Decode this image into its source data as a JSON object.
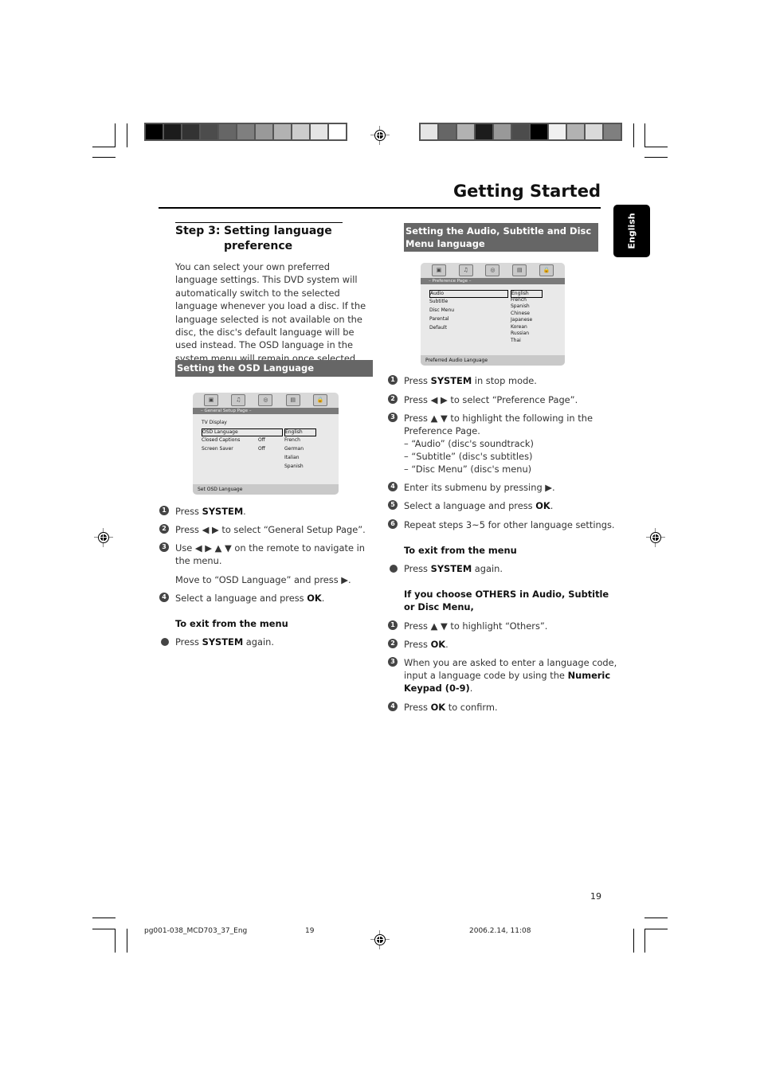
{
  "header": {
    "title": "Getting Started",
    "side_tab": "English",
    "color_bar_left": [
      "#000000",
      "#1c1c1c",
      "#333333",
      "#4c4c4c",
      "#666666",
      "#7f7f7f",
      "#999999",
      "#b2b2b2",
      "#cccccc",
      "#e5e5e5",
      "#ffffff"
    ],
    "color_bar_right": [
      "#e5e5e5",
      "#666666",
      "#b2b2b2",
      "#1c1c1c",
      "#999999",
      "#4c4c4c",
      "#000000",
      "#f0f0f0",
      "#b2b2b2",
      "#d9d9d9",
      "#7f7f7f"
    ]
  },
  "left": {
    "step_label": "Step 3:",
    "step_title_1": "Setting language",
    "step_title_2": "preference",
    "intro": "You can select your own preferred language settings. This DVD system will automatically switch to the selected language whenever you load a disc. If the language selected is not available on the disc, the disc's default language will be used instead. The OSD language in the system menu will remain once selected.",
    "section_header": "Setting the OSD Language",
    "osd": {
      "page_title": "– General Setup Page –",
      "icons": [
        "tv-icon",
        "audio-icon",
        "disc-icon",
        "video-icon",
        "lock-icon"
      ],
      "rows": [
        {
          "label": "TV Display",
          "value": ""
        },
        {
          "label": "OSD Language",
          "value": ""
        },
        {
          "label": "Closed Captions",
          "value": "Off"
        },
        {
          "label": "Screen Saver",
          "value": "Off"
        }
      ],
      "options": [
        "English",
        "French",
        "German",
        "Italian",
        "Spanish"
      ],
      "footer": "Set OSD Language"
    },
    "steps": [
      {
        "num": "1",
        "pre": "Press ",
        "bold": "SYSTEM",
        "post": "."
      },
      {
        "num": "2",
        "pre": "Press ◀ ▶  to select “General Setup Page”.",
        "bold": "",
        "post": ""
      },
      {
        "num": "3",
        "pre": "Use ◀ ▶ ▲ ▼  on the remote to navigate in",
        "bold": "",
        "post": ""
      },
      {
        "num": "",
        "pre": "the menu.",
        "bold": "",
        "post": ""
      },
      {
        "num": "",
        "pre": "Move to “OSD Language” and press ▶.",
        "bold": "",
        "post": ""
      },
      {
        "num": "4",
        "pre": "Select a language and press ",
        "bold": "OK",
        "post": "."
      }
    ],
    "exit_heading": "To exit from the menu",
    "exit_step": {
      "pre": "Press ",
      "bold": "SYSTEM",
      "post": " again."
    }
  },
  "right": {
    "section_header_1": "Setting the Audio, Subtitle and Disc",
    "section_header_2": "Menu language",
    "osd": {
      "page_title": "– Preference Page –",
      "icons": [
        "tv-icon",
        "audio-icon",
        "disc-icon",
        "video-icon",
        "lock-icon"
      ],
      "rows": [
        "Audio",
        "Subtitle",
        "Disc Menu",
        "Parental",
        "Default"
      ],
      "options": [
        "English",
        "French",
        "Spanish",
        "Chinese",
        "Japanese",
        "Korean",
        "Russian",
        "Thai"
      ],
      "footer": "Preferred Audio Language"
    },
    "steps": [
      {
        "num": "1",
        "pre": "Press ",
        "bold": "SYSTEM",
        "post": " in stop mode."
      },
      {
        "num": "2",
        "pre": "Press ◀ ▶  to select “Preference Page”.",
        "bold": "",
        "post": ""
      },
      {
        "num": "3",
        "pre": "Press ▲ ▼  to highlight the following in the",
        "bold": "",
        "post": ""
      },
      {
        "num": "",
        "pre": "Preference Page.",
        "bold": "",
        "post": ""
      },
      {
        "num": "",
        "pre": "–   “Audio” (disc's soundtrack)",
        "bold": "",
        "post": ""
      },
      {
        "num": "",
        "pre": "–   “Subtitle” (disc's subtitles)",
        "bold": "",
        "post": ""
      },
      {
        "num": "",
        "pre": "–   “Disc Menu” (disc's menu)",
        "bold": "",
        "post": ""
      },
      {
        "num": "4",
        "pre": "Enter its submenu by pressing ▶.",
        "bold": "",
        "post": ""
      },
      {
        "num": "5",
        "pre": "Select a language and press ",
        "bold": "OK",
        "post": "."
      },
      {
        "num": "6",
        "pre": "Repeat steps 3~5 for other language settings.",
        "bold": "",
        "post": ""
      }
    ],
    "exit_heading": "To exit from the menu",
    "exit_step": {
      "pre": "Press ",
      "bold": "SYSTEM",
      "post": " again."
    },
    "others_heading_1": "If you choose OTHERS in Audio, Subtitle",
    "others_heading_2": "or Disc Menu,",
    "others_steps": [
      {
        "num": "1",
        "pre": "Press ▲ ▼  to highlight “Others”.",
        "bold": "",
        "post": ""
      },
      {
        "num": "2",
        "pre": "Press ",
        "bold": "OK",
        "post": "."
      },
      {
        "num": "3",
        "pre": "When you are asked to enter a language code,",
        "bold": "",
        "post": ""
      },
      {
        "num": "",
        "pre": "input a language code by using the ",
        "bold": "Numeric",
        "post": ""
      },
      {
        "num": "",
        "pre": "",
        "bold": "Keypad (0-9)",
        "post": "."
      },
      {
        "num": "4",
        "pre": "Press ",
        "bold": "OK",
        "post": " to confirm."
      }
    ]
  },
  "footer": {
    "page_number": "19",
    "file_name": "pg001-038_MCD703_37_Eng",
    "slug_page": "19",
    "timestamp": "2006.2.14, 11:08"
  }
}
